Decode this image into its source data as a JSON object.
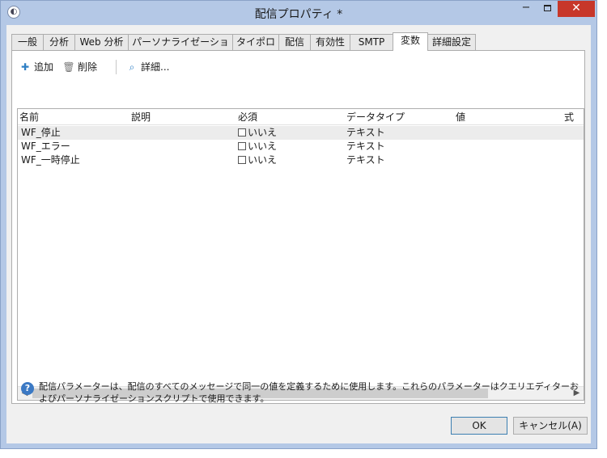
{
  "window": {
    "title": "配信プロパティ *",
    "minimize_glyph": "−",
    "close_glyph": "✕"
  },
  "tabs": [
    {
      "label": "一般",
      "active": false
    },
    {
      "label": "分析",
      "active": false
    },
    {
      "label": "Web 分析",
      "active": false
    },
    {
      "label": "パーソナライゼーション",
      "active": false
    },
    {
      "label": "タイポロジ",
      "active": false
    },
    {
      "label": "配信",
      "active": false
    },
    {
      "label": "有効性",
      "active": false
    },
    {
      "label": "SMTP",
      "active": false
    },
    {
      "label": "変数",
      "active": true
    },
    {
      "label": "詳細設定",
      "active": false
    }
  ],
  "toolbar": {
    "add_label": "追加",
    "delete_label": "削除",
    "detail_label": "詳細..."
  },
  "grid": {
    "columns": [
      "名前",
      "説明",
      "必須",
      "データタイプ",
      "値",
      "式"
    ],
    "rows": [
      {
        "name": "WF_停止",
        "description": "",
        "required": "いいえ",
        "data_type": "テキスト",
        "value": "",
        "expression": "",
        "selected": true
      },
      {
        "name": "WF_エラー",
        "description": "",
        "required": "いいえ",
        "data_type": "テキスト",
        "value": "",
        "expression": "",
        "selected": false
      },
      {
        "name": "WF_一時停止",
        "description": "",
        "required": "いいえ",
        "data_type": "テキスト",
        "value": "",
        "expression": "",
        "selected": false
      }
    ]
  },
  "info": {
    "text": "配信パラメーターは、配信のすべてのメッセージで同一の値を定義するために使用します。これらのパラメーターはクエリエディターおよびパーソナライゼーションスクリプトで使用できます。"
  },
  "buttons": {
    "ok_label": "OK",
    "cancel_label": "キャンセル(A)"
  },
  "colors": {
    "titlebar": "#b4c8e6",
    "close_button": "#c7372a",
    "selected_row": "#ececec",
    "help_icon": "#3b79c4"
  }
}
